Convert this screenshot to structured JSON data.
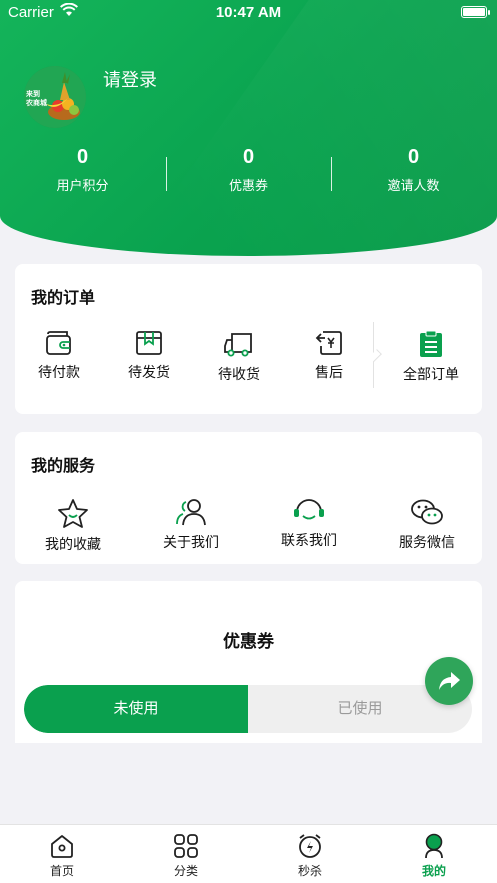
{
  "status_bar": {
    "carrier": "Carrier",
    "time": "10:47 AM"
  },
  "profile": {
    "login_label": "请登录",
    "avatar_lines": [
      "来到",
      "农商城"
    ]
  },
  "stats": [
    {
      "value": "0",
      "label": "用户积分"
    },
    {
      "value": "0",
      "label": "优惠券"
    },
    {
      "value": "0",
      "label": "邀请人数"
    }
  ],
  "orders": {
    "title": "我的订单",
    "items": [
      {
        "label": "待付款",
        "icon": "wallet-icon"
      },
      {
        "label": "待发货",
        "icon": "box-icon"
      },
      {
        "label": "待收货",
        "icon": "truck-icon"
      },
      {
        "label": "售后",
        "icon": "refund-icon"
      },
      {
        "label": "全部订单",
        "icon": "clipboard-icon"
      }
    ]
  },
  "services": {
    "title": "我的服务",
    "items": [
      {
        "label": "我的收藏",
        "icon": "star-icon"
      },
      {
        "label": "关于我们",
        "icon": "people-icon"
      },
      {
        "label": "联系我们",
        "icon": "headset-icon"
      },
      {
        "label": "服务微信",
        "icon": "wechat-icon"
      }
    ]
  },
  "coupons": {
    "title": "优惠券",
    "tabs": [
      {
        "label": "未使用",
        "active": true
      },
      {
        "label": "已使用",
        "active": false
      }
    ]
  },
  "tabbar": [
    {
      "label": "首页",
      "icon": "home-icon",
      "active": false
    },
    {
      "label": "分类",
      "icon": "category-icon",
      "active": false
    },
    {
      "label": "秒杀",
      "icon": "alarm-icon",
      "active": false
    },
    {
      "label": "我的",
      "icon": "profile-icon",
      "active": true
    }
  ],
  "colors": {
    "brand": "#0aa04e",
    "accent_dark": "#079a48",
    "fab": "#2fa55a"
  }
}
